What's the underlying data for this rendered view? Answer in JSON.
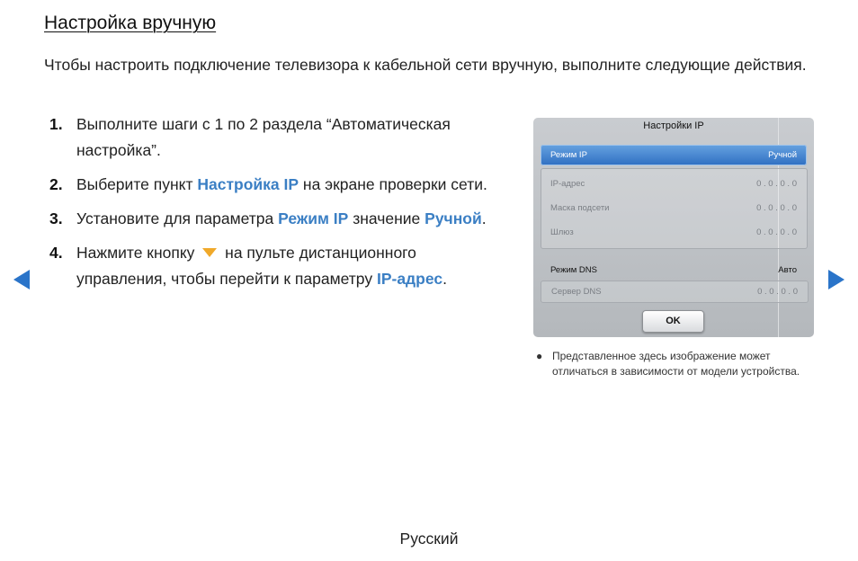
{
  "page": {
    "title": "Настройка вручную",
    "intro": "Чтобы настроить подключение телевизора к кабельной сети вручную, выполните следующие действия.",
    "footer": "Русский"
  },
  "steps": [
    {
      "num": "1.",
      "text": "Выполните шаги с 1 по 2 раздела “Автоматическая настройка”."
    },
    {
      "num": "2.",
      "before": "Выберите пункт ",
      "hl": "Настройка IP",
      "after": " на экране проверки сети."
    },
    {
      "num": "3.",
      "before": "Установите для параметра ",
      "hl": "Режим IP",
      "mid": " значение ",
      "hl2": "Ручной",
      "after": "."
    },
    {
      "num": "4.",
      "before": "Нажмите кнопку ",
      "after_icon": " на пульте дистанционного управления, чтобы перейти к параметру ",
      "hl": "IP-адрес",
      "after": "."
    }
  ],
  "tv_screen": {
    "title": "Настройки IP",
    "ip_mode": {
      "label": "Режим IP",
      "value": "Ручной"
    },
    "ip_address": {
      "label": "IP-адрес",
      "value": "0 . 0 . 0 . 0"
    },
    "subnet_mask": {
      "label": "Маска подсети",
      "value": "0 . 0 . 0 . 0"
    },
    "gateway": {
      "label": "Шлюз",
      "value": "0 . 0 . 0 . 0"
    },
    "dns_mode": {
      "label": "Режим DNS",
      "value": "Авто"
    },
    "dns_server": {
      "label": "Сервер DNS",
      "value": "0 . 0 . 0 . 0"
    },
    "ok_label": "OK"
  },
  "note": {
    "bullet": "●",
    "text": "Представленное здесь изображение может отличаться в зависимости от модели устройства."
  },
  "icons": {
    "prev": "left-arrow-icon",
    "next": "right-arrow-icon",
    "down": "down-triangle-icon"
  },
  "colors": {
    "highlight": "#3b7fc4",
    "nav_arrow": "#2a74c9",
    "down_arrow": "#f0a92a"
  }
}
